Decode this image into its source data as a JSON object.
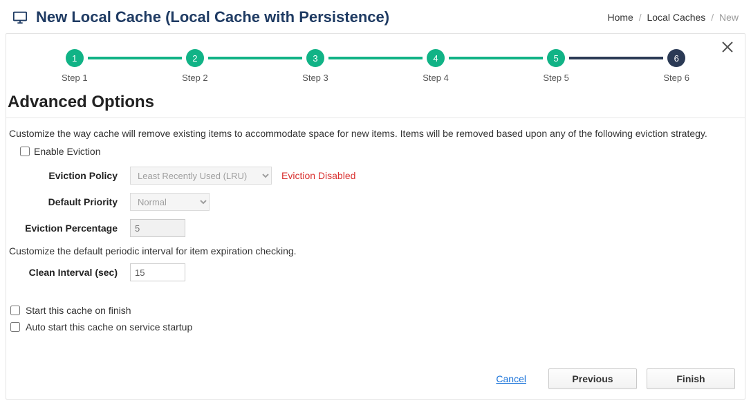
{
  "header": {
    "title": "New Local Cache (Local Cache with Persistence)"
  },
  "breadcrumb": {
    "home": "Home",
    "mid": "Local Caches",
    "current": "New"
  },
  "steps": [
    {
      "num": "1",
      "label": "Step 1"
    },
    {
      "num": "2",
      "label": "Step 2"
    },
    {
      "num": "3",
      "label": "Step 3"
    },
    {
      "num": "4",
      "label": "Step 4"
    },
    {
      "num": "5",
      "label": "Step 5"
    },
    {
      "num": "6",
      "label": "Step 6"
    }
  ],
  "section": {
    "title": "Advanced Options",
    "desc_eviction": "Customize the way cache will remove existing items to accommodate space for new items. Items will be removed based upon any of the following eviction strategy.",
    "enable_eviction_label": "Enable Eviction",
    "eviction_policy_label": "Eviction Policy",
    "eviction_policy_value": "Least Recently Used (LRU)",
    "eviction_disabled_warn": "Eviction Disabled",
    "default_priority_label": "Default Priority",
    "default_priority_value": "Normal",
    "eviction_percentage_label": "Eviction Percentage",
    "eviction_percentage_value": "5",
    "desc_clean": "Customize the default periodic interval for item expiration checking.",
    "clean_interval_label": "Clean Interval (sec)",
    "clean_interval_value": "15",
    "start_on_finish_label": "Start this cache on finish",
    "auto_start_label": "Auto start this cache on service startup"
  },
  "footer": {
    "cancel": "Cancel",
    "previous": "Previous",
    "finish": "Finish"
  }
}
